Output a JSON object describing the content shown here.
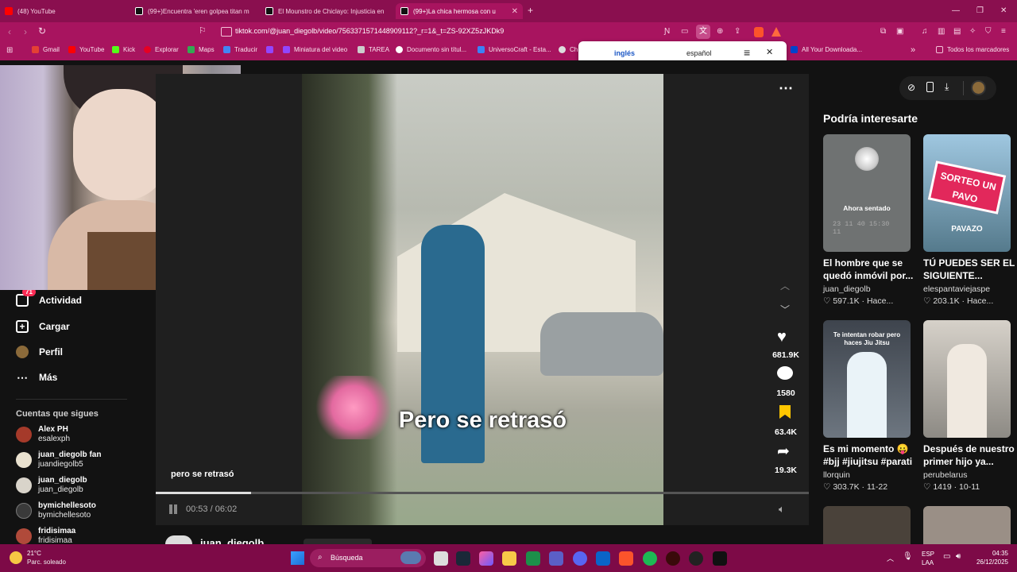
{
  "tabs": [
    {
      "title": "(48) YouTube",
      "icon_color": "#ff0000"
    },
    {
      "title": "(99+)Encuentra 'eren golpea titan m",
      "icon_color": "#111111"
    },
    {
      "title": "El Mounstro de Chiclayo: Injusticia en",
      "icon_color": "#111111"
    },
    {
      "title": "(99+)La chica hermosa con u",
      "icon_color": "#111111"
    }
  ],
  "address": {
    "url": "tiktok.com/@juan_diegolb/video/7563371571448909112?_r=1&_t=ZS-92XZ5zJKDk9"
  },
  "bookmarks": [
    {
      "label": "Gmail",
      "color": "#e44134"
    },
    {
      "label": "YouTube",
      "color": "#ff0000"
    },
    {
      "label": "Kick",
      "color": "#53fc18"
    },
    {
      "label": "Explorar",
      "color": "#e60023"
    },
    {
      "label": "Maps",
      "color": "#34a853"
    },
    {
      "label": "Traducir",
      "color": "#4285f4"
    },
    {
      "label": "",
      "color": "#9146ff"
    },
    {
      "label": "Miniatura del video",
      "color": "#9146ff"
    },
    {
      "label": "TAREA",
      "color": "#cccccc"
    },
    {
      "label": "Documento sin títul...",
      "color": "#ffffff"
    },
    {
      "label": "UniversoCraft - Esta...",
      "color": "#3b82f6"
    },
    {
      "label": "Ch",
      "color": "#dddddd"
    },
    {
      "label": "All Your Downloada...",
      "color": "#0044cc"
    },
    {
      "label": "Todos los marcadores",
      "color": "#f3c1d8"
    }
  ],
  "translate": {
    "lang_from": "inglés",
    "lang_to": "español"
  },
  "nav": {
    "items": [
      {
        "label": "Actividad",
        "badge": "71"
      },
      {
        "label": "Cargar"
      },
      {
        "label": "Perfil"
      },
      {
        "label": "Más"
      }
    ],
    "following_title": "Cuentas que sigues",
    "following": [
      {
        "name": "Alex PH",
        "handle": "esalexph"
      },
      {
        "name": "juan_diegolb fan",
        "handle": "juandiegolb5"
      },
      {
        "name": "juan_diegolb",
        "handle": "juan_diegolb"
      },
      {
        "name": "bymichellesoto",
        "handle": "bymichellesoto"
      },
      {
        "name": "fridisimaa",
        "handle": "fridisimaa"
      }
    ]
  },
  "video": {
    "caption": "Pero se retrasó",
    "subtitle": "pero se retrasó",
    "time": "00:53 / 06:02",
    "progress": 0.146,
    "author": "juan_diegolb",
    "likes": "681.9K",
    "comments": "1580",
    "saves": "63.4K",
    "shares": "19.3K"
  },
  "suggestions": {
    "heading": "Podría interesarte",
    "items": [
      {
        "title": "El hombre que se quedó inmóvil por...",
        "author": "juan_diegolb",
        "likes": "597.1K",
        "date": "Hace...",
        "overlay": "Ahora sentado",
        "overlay2": "23 11 40  15:30 11"
      },
      {
        "title": "TÚ PUEDES SER EL SIGUIENTE...",
        "author": "elespantaviejaspe",
        "likes": "203.1K",
        "date": "Hace...",
        "overlay": "SORTEO UN PAVO",
        "overlay2": "PAVAZO"
      },
      {
        "title": "Es mi momento 😛 #bjj #jiujitsu #parati",
        "author": "llorquin",
        "likes": "303.7K",
        "date": "11-22",
        "overlay": "Te intentan robar pero haces Jiu Jitsu"
      },
      {
        "title": "Después de nuestro primer hijo ya...",
        "author": "perubelarus",
        "likes": "1419",
        "date": "10-11",
        "overlay": ""
      }
    ]
  },
  "taskbar": {
    "weather_temp": "21°C",
    "weather_desc": "Parc. soleado",
    "search_label": "Búsqueda",
    "lang": "ESP",
    "lang2": "LAA",
    "time": "04:35",
    "date": "26/12/2025"
  }
}
